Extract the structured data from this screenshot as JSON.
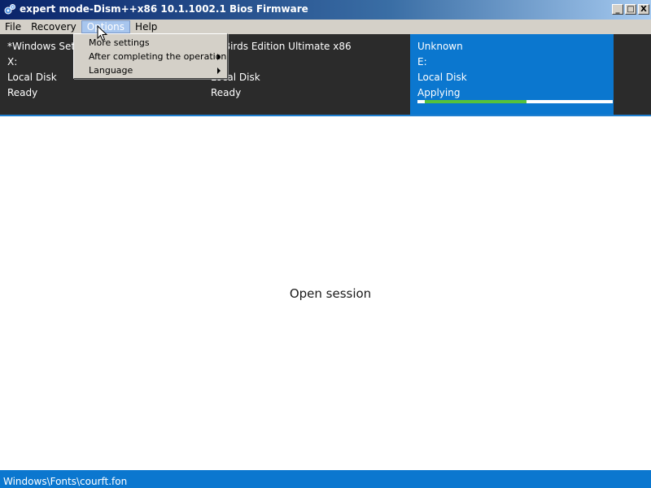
{
  "window": {
    "title": "expert mode-Dism++x86 10.1.1002.1 Bios Firmware",
    "controls": {
      "minimize": "_",
      "maximize": "□",
      "close": "X"
    }
  },
  "menubar": {
    "items": [
      "File",
      "Recovery",
      "Options",
      "Help"
    ],
    "active": "Options"
  },
  "options_menu": {
    "items": [
      {
        "label": "More settings",
        "submenu": false
      },
      {
        "label": "After completing the operation",
        "submenu": true
      },
      {
        "label": "Language",
        "submenu": true
      }
    ]
  },
  "sessions": [
    {
      "name": "*Windows Setu",
      "drive": "X:",
      "type": "Local Disk",
      "status": "Ready"
    },
    {
      "name": "ry Birds Edition Ultimate x86",
      "drive": "",
      "type": "Local Disk",
      "status": "Ready"
    },
    {
      "name": "Unknown",
      "drive": "E:",
      "type": "Local Disk",
      "status": "Applying",
      "progress": 0.52
    }
  ],
  "main": {
    "message": "Open session"
  },
  "statusbar": {
    "text": "Windows\\Fonts\\courft.fon"
  },
  "colors": {
    "panel_bg": "#2b2b2b",
    "selected_session_bg": "#0b77cf",
    "statusbar_bg": "#0b77cf",
    "progress_fill": "#57c23b"
  }
}
